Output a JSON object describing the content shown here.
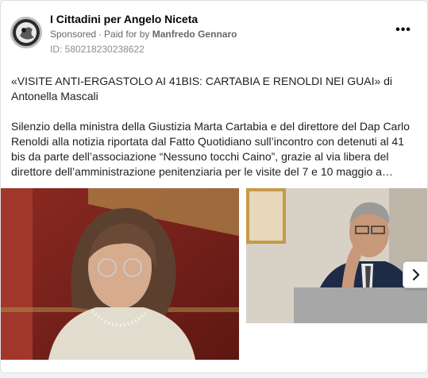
{
  "post": {
    "page_name": "I Cittadini per Angelo Niceta",
    "sponsored_label": "Sponsored",
    "paid_prefix": "Paid for by",
    "payer": "Manfredo Gennaro",
    "ad_id": "ID: 580218230238622",
    "more_icon": "more-horizontal-icon",
    "headline": "«VISITE ANTI-ERGASTOLO AI 41BIS: CARTABIA E RENOLDI NEI GUAI» di Antonella Mascali",
    "body": "Silenzio della ministra della Giustizia Marta Cartabia e del direttore del Dap Carlo Renoldi alla notizia riportata dal Fatto Quotidiano sull’incontro con detenuti al 41 bis da parte dell’associazione “Nessuno tocchi Caino”, grazie al via libera del direttore dell’amministrazione penitenziaria per le visite del 7 e 10 maggio a…"
  },
  "carousel": {
    "next_icon": "chevron-right-icon"
  },
  "colors": {
    "card_bg": "#ffffff",
    "page_bg": "#f0f2f5",
    "meta_text": "#65676b"
  }
}
